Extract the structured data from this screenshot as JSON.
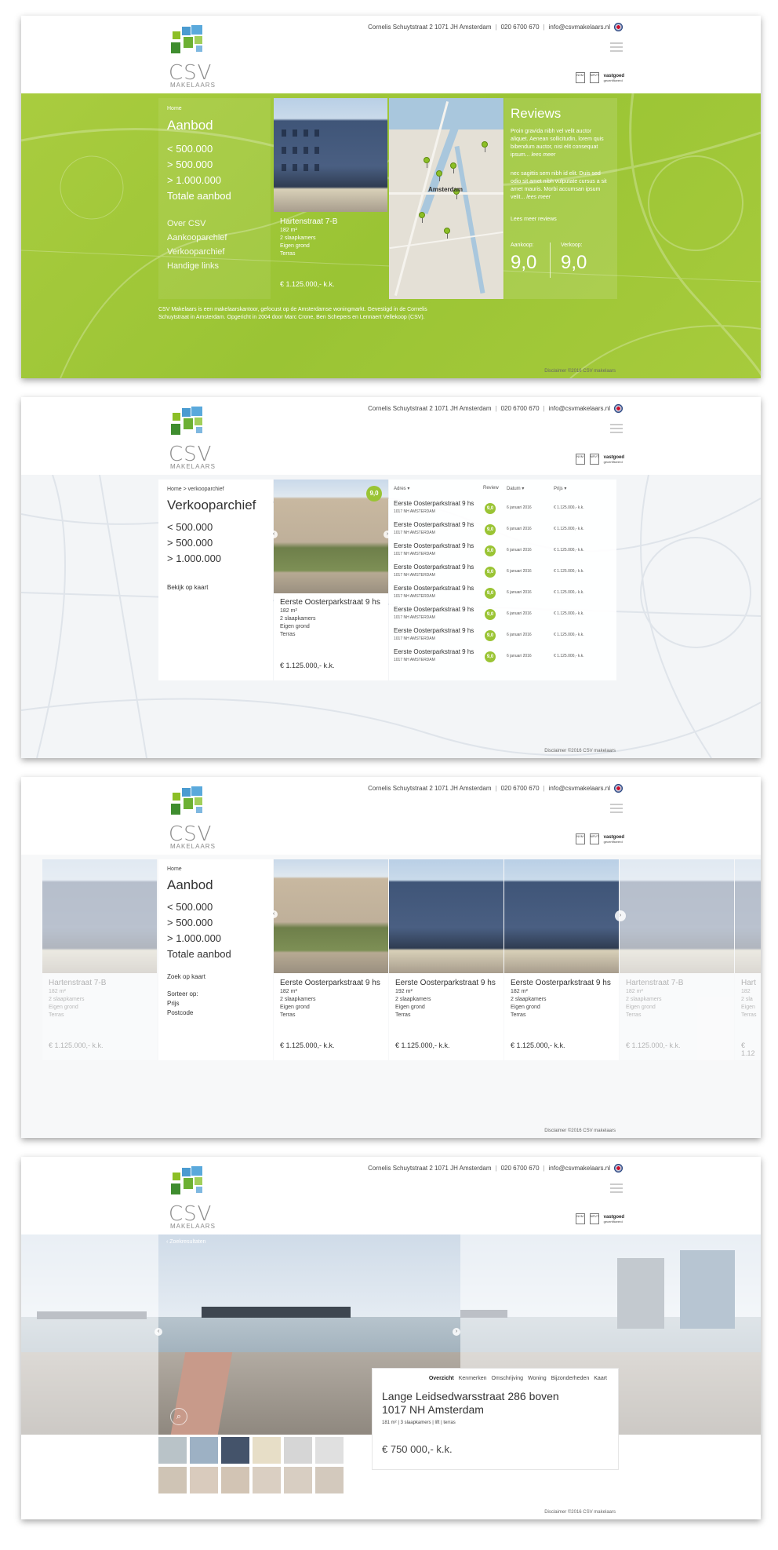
{
  "header": {
    "logo_text": "CSV",
    "logo_sub": "MAKELAARS",
    "address": "Cornelis Schuytstraat 2  1071 JH Amsterdam",
    "phone": "020 6700 670",
    "email": "info@csvmakelaars.nl",
    "sep": "|",
    "cert_vastgoed": "vastgoed",
    "cert_vastgoed_sub": "gecertificeerd",
    "cert_nvm": "NVM",
    "cert_nrvt": "NRVT"
  },
  "panel1": {
    "crumb": "Home",
    "title": "Aanbod",
    "prices": [
      "< 500.000",
      "> 500.000",
      "> 1.000.000"
    ],
    "total": "Totale aanbod",
    "links": [
      "Over CSV",
      "Aankooparchief",
      "Verkooparchief",
      "Handige links"
    ],
    "card": {
      "title": "Hartenstraat 7-B",
      "area": "182 m²",
      "rooms": "2 slaapkamers",
      "ground": "Eigen grond",
      "extra": "Terras",
      "price": "€ 1.125.000,- k.k."
    },
    "map_label": "Amsterdam",
    "reviews": {
      "title": "Reviews",
      "text1": "Proin gravida nibh vel velit auctor aliquet. Aenean sollicitudin, lorem quis bibendum auctor, nisi elit consequat ipsum...",
      "more1": "lees meer",
      "text2": "nec sagittis sem nibh id elit. Duis sed odio sit amet nibh vulputate cursus a sit amet mauris. Morbi accumsan ipsum velit...",
      "more2": "lees meer",
      "more_all": "Lees meer reviews",
      "buy_label": "Aankoop:",
      "buy_score": "9,0",
      "sell_label": "Verkoop:",
      "sell_score": "9,0"
    },
    "about": "CSV Makelaars is een makelaarskantoor, gefocust op de Amsterdamse woningmarkt. Gevestigd in de Cornelis Schuytstraat in Amsterdam. Opgericht in 2004 door Marc Crone, Ben Schepers en Lennaert Vellekoop (CSV).",
    "disclaimer": "Disclaimer ©2016 CSV makelaars"
  },
  "panel2": {
    "crumb": "Home > verkooparchief",
    "title": "Verkooparchief",
    "prices": [
      "< 500.000",
      "> 500.000",
      "> 1.000.000"
    ],
    "map_link": "Bekijk op kaart",
    "badge": "9,0",
    "card": {
      "title": "Eerste Oosterparkstraat 9 hs",
      "area": "182 m²",
      "rooms": "2 slaapkamers",
      "ground": "Eigen grond",
      "extra": "Terras",
      "price": "€ 1.125.000,- k.k."
    },
    "table": {
      "headers": [
        "Adres ▾",
        "Review",
        "Datum ▾",
        "Prijs ▾"
      ],
      "rows": [
        {
          "addr": "Eerste Oosterparkstraat 9 hs",
          "zip": "1017 NH AMSTERDAM",
          "review": "9,0",
          "date": "6 januari 2016",
          "price": "€ 1.125.000,- k.k."
        },
        {
          "addr": "Eerste Oosterparkstraat 9 hs",
          "zip": "1017 NH AMSTERDAM",
          "review": "9,0",
          "date": "6 januari 2016",
          "price": "€ 1.125.000,- k.k."
        },
        {
          "addr": "Eerste Oosterparkstraat 9 hs",
          "zip": "1017 NH AMSTERDAM",
          "review": "9,0",
          "date": "6 januari 2016",
          "price": "€ 1.125.000,- k.k."
        },
        {
          "addr": "Eerste Oosterparkstraat 9 hs",
          "zip": "1017 NH AMSTERDAM",
          "review": "9,0",
          "date": "6 januari 2016",
          "price": "€ 1.125.000,- k.k."
        },
        {
          "addr": "Eerste Oosterparkstraat 9 hs",
          "zip": "1017 NH AMSTERDAM",
          "review": "9,0",
          "date": "6 januari 2016",
          "price": "€ 1.125.000,- k.k."
        },
        {
          "addr": "Eerste Oosterparkstraat 9 hs",
          "zip": "1017 NH AMSTERDAM",
          "review": "9,0",
          "date": "6 januari 2016",
          "price": "€ 1.125.000,- k.k."
        },
        {
          "addr": "Eerste Oosterparkstraat 9 hs",
          "zip": "1017 NH AMSTERDAM",
          "review": "9,0",
          "date": "6 januari 2016",
          "price": "€ 1.125.000,- k.k."
        },
        {
          "addr": "Eerste Oosterparkstraat 9 hs",
          "zip": "1017 NH AMSTERDAM",
          "review": "9,0",
          "date": "6 januari 2016",
          "price": "€ 1.125.000,- k.k."
        }
      ]
    },
    "disclaimer": "Disclaimer ©2016 CSV makelaars"
  },
  "panel3": {
    "crumb": "Home",
    "title": "Aanbod",
    "prices": [
      "< 500.000",
      "> 500.000",
      "> 1.000.000"
    ],
    "total": "Totale aanbod",
    "map_link": "Zoek op kaart",
    "sort_label": "Sorteer op:",
    "sort_options": [
      "Prijs",
      "Postcode"
    ],
    "faded_card": {
      "title": "Hartenstraat 7-B",
      "area": "182 m²",
      "rooms": "2 slaapkamers",
      "ground": "Eigen grond",
      "extra": "Terras",
      "price": "€ 1.125.000,- k.k."
    },
    "faded_card_right": {
      "title": "Hart",
      "area": "182",
      "rooms": "2 sla",
      "ground": "Eigen",
      "extra": "Terras",
      "price": "€ 1.12"
    },
    "cards": [
      {
        "title": "Eerste Oosterparkstraat 9 hs",
        "area": "182 m²",
        "rooms": "2 slaapkamers",
        "ground": "Eigen grond",
        "extra": "Terras",
        "price": "€ 1.125.000,- k.k."
      },
      {
        "title": "Eerste Oosterparkstraat 9 hs",
        "area": "192 m²",
        "rooms": "2 slaapkamers",
        "ground": "Eigen grond",
        "extra": "Terras",
        "price": "€ 1.125.000,- k.k."
      },
      {
        "title": "Eerste Oosterparkstraat 9 hs",
        "area": "182 m²",
        "rooms": "2 slaapkamers",
        "ground": "Eigen grond",
        "extra": "Terras",
        "price": "€ 1.125.000,- k.k."
      }
    ],
    "disclaimer": "Disclaimer ©2016 CSV makelaars"
  },
  "panel4": {
    "back": "‹ Zoekresultaten",
    "tabs": [
      "Overzicht",
      "Kenmerken",
      "Omschrijving",
      "Woning",
      "Bijzonderheden",
      "Kaart"
    ],
    "title_line1": "Lange Leidsedwarsstraat 286 boven",
    "title_line2": "1017 NH Amsterdam",
    "meta": "181 m²  |  3 slaapkamers  |  lift  |  terras",
    "price": "€ 750 000,- k.k.",
    "disclaimer": "Disclaimer ©2016 CSV makelaars"
  }
}
